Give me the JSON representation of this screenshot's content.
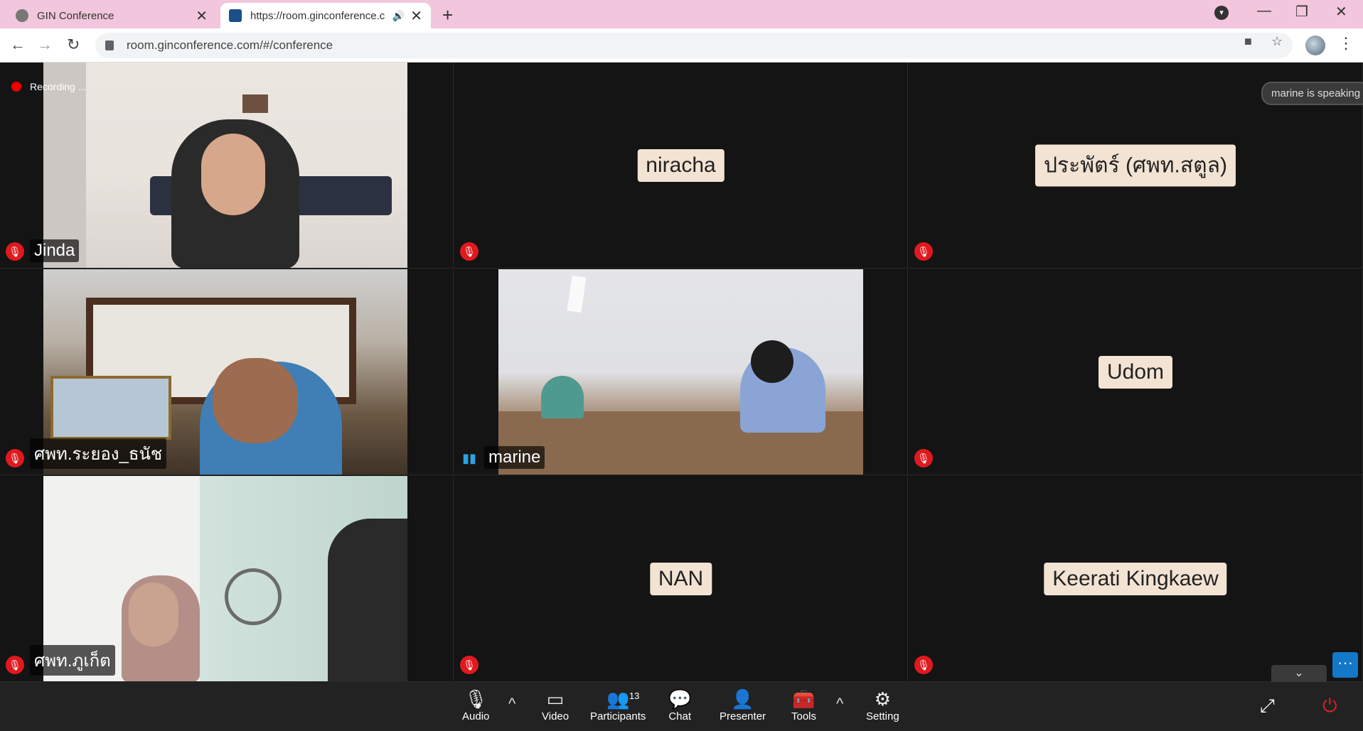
{
  "browser": {
    "tabs": [
      {
        "title": "GIN Conference",
        "active": false
      },
      {
        "title": "https://room.ginconference.c",
        "active": true
      }
    ],
    "url": "room.ginconference.com/#/conference"
  },
  "conference": {
    "recording_label": "Recording ...",
    "speaking_notice": "marine is speaking",
    "participants": [
      {
        "name": "Jinda",
        "video": true,
        "muted": true
      },
      {
        "name": "niracha",
        "video": false,
        "muted": true
      },
      {
        "name": "ประพัตร์ (ศพท.สตูล)",
        "video": false,
        "muted": true
      },
      {
        "name": "ศพท.ระยอง_ธนัช",
        "video": true,
        "muted": true
      },
      {
        "name": "marine",
        "video": true,
        "muted": false,
        "speaking": true
      },
      {
        "name": "Udom",
        "video": false,
        "muted": true
      },
      {
        "name": "ศพท.ภูเก็ต",
        "video": true,
        "muted": true
      },
      {
        "name": "NAN",
        "video": false,
        "muted": true
      },
      {
        "name": "Keerati Kingkaew",
        "video": false,
        "muted": true
      }
    ]
  },
  "toolbar": {
    "audio": "Audio",
    "video": "Video",
    "participants": "Participants",
    "participants_count": "13",
    "chat": "Chat",
    "presenter": "Presenter",
    "tools": "Tools",
    "setting": "Setting"
  },
  "colors": {
    "tabbar": "#f2c6dc",
    "mic_off": "#e0191e",
    "speaking_indicator": "#2aa6e0",
    "namecard": "#f3e3d3",
    "more_button": "#1478c8"
  }
}
